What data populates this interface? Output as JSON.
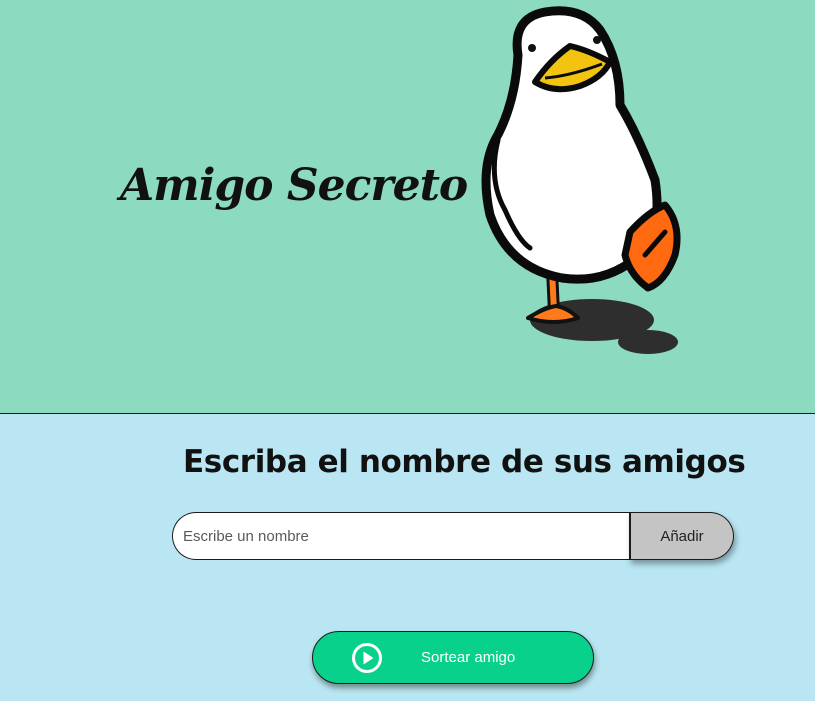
{
  "header": {
    "title": "Amigo Secreto",
    "image_icon": "duck-illustration"
  },
  "main": {
    "subtitle": "Escriba el nombre de sus amigos",
    "name_input": {
      "placeholder": "Escribe un nombre",
      "value": ""
    },
    "add_button_label": "Añadir",
    "draw_button": {
      "label": "Sortear amigo",
      "icon": "play-circle-icon"
    }
  },
  "colors": {
    "header_background": "#8cdbc1",
    "main_background": "#b9e6f2",
    "add_button": "#c4c4c4",
    "draw_button": "#07d18b"
  }
}
